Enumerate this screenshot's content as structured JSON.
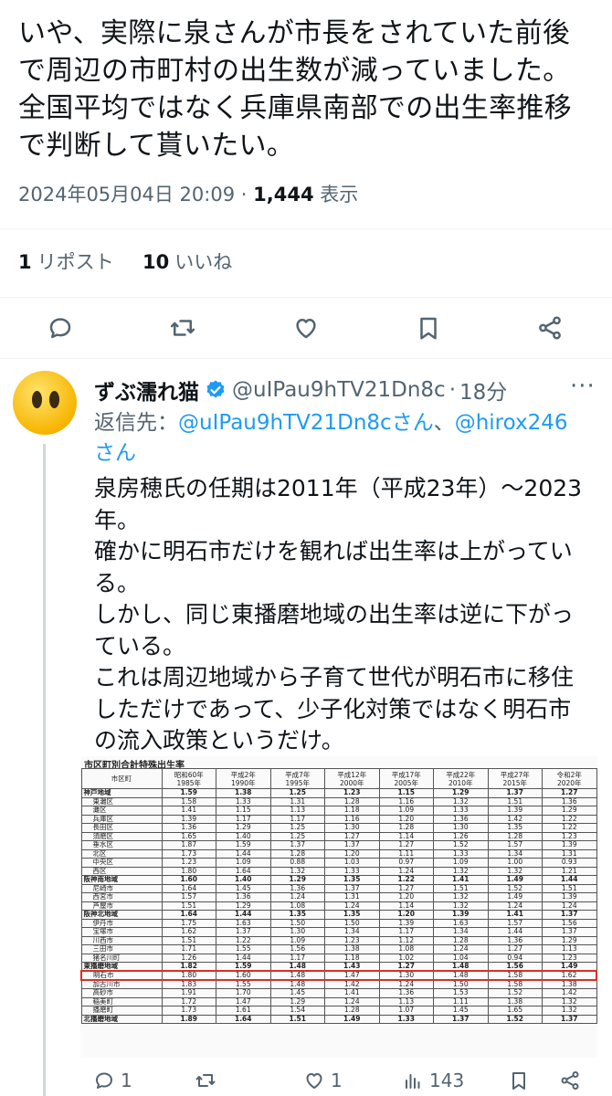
{
  "main_tweet": {
    "text": "いや、実際に泉さんが市長をされていた前後\nで周辺の市町村の出生数が減っていました。\n全国平均ではなく兵庫県南部での出生率推移\nで判断して貰いたい。",
    "timestamp": "2024年05月04日 20:09",
    "separator": "·",
    "views_count": "1,444",
    "views_label": "表示",
    "reposts_count": "1",
    "reposts_label": "リポスト",
    "likes_count": "10",
    "likes_label": "いいね"
  },
  "reply": {
    "display_name": "ずぶ濡れ猫",
    "handle": "@uIPau9hTV21Dn8c",
    "separator": "·",
    "time": "18分",
    "more": "···",
    "replying_label": "返信先：",
    "mention1": "@uIPau9hTV21Dn8cさん",
    "mention_sep": "、",
    "mention2": "@hirox246",
    "mention_suffix": "さん",
    "text": "泉房穂氏の任期は2011年（平成23年）～2023\n年。\n確かに明石市だけを観れば出生率は上がってい\nる。\nしかし、同じ東播磨地域の出生率は逆に下がっ\nている。\nこれは周辺地域から子育て世代が明石市に移住\nしただけであって、少子化対策ではなく明石市\nの流入政策というだけ。",
    "metrics": {
      "replies": "1",
      "reposts": "",
      "likes": "1",
      "views": "143"
    }
  },
  "table": {
    "caption": "市区町別合計特殊出生率",
    "headers": [
      "市区町",
      "昭和60年\n1985年",
      "平成2年\n1990年",
      "平成7年\n1995年",
      "平成12年\n2000年",
      "平成17年\n2005年",
      "平成22年\n2010年",
      "平成27年\n2015年",
      "令和2年\n2020年"
    ],
    "rows": [
      {
        "name": "神戸地域",
        "type": "region",
        "v": [
          "1.59",
          "1.38",
          "1.25",
          "1.23",
          "1.15",
          "1.29",
          "1.37",
          "1.27"
        ]
      },
      {
        "name": "東灘区",
        "v": [
          "1.58",
          "1.33",
          "1.31",
          "1.28",
          "1.16",
          "1.32",
          "1.51",
          "1.36"
        ]
      },
      {
        "name": "灘区",
        "v": [
          "1.41",
          "1.15",
          "1.13",
          "1.18",
          "1.09",
          "1.33",
          "1.39",
          "1.29"
        ]
      },
      {
        "name": "兵庫区",
        "v": [
          "1.39",
          "1.17",
          "1.17",
          "1.16",
          "1.20",
          "1.36",
          "1.42",
          "1.22"
        ]
      },
      {
        "name": "長田区",
        "v": [
          "1.36",
          "1.29",
          "1.25",
          "1.30",
          "1.28",
          "1.30",
          "1.35",
          "1.22"
        ]
      },
      {
        "name": "須磨区",
        "v": [
          "1.65",
          "1.40",
          "1.25",
          "1.27",
          "1.14",
          "1.26",
          "1.28",
          "1.23"
        ]
      },
      {
        "name": "垂水区",
        "v": [
          "1.87",
          "1.59",
          "1.37",
          "1.37",
          "1.27",
          "1.52",
          "1.57",
          "1.39"
        ]
      },
      {
        "name": "北区",
        "v": [
          "1.73",
          "1.44",
          "1.28",
          "1.20",
          "1.11",
          "1.33",
          "1.34",
          "1.31"
        ]
      },
      {
        "name": "中央区",
        "v": [
          "1.23",
          "1.09",
          "0.88",
          "1.03",
          "0.97",
          "1.09",
          "1.00",
          "0.93"
        ]
      },
      {
        "name": "西区",
        "v": [
          "1.80",
          "1.64",
          "1.32",
          "1.33",
          "1.24",
          "1.32",
          "1.32",
          "1.21"
        ]
      },
      {
        "name": "阪神南地域",
        "type": "region",
        "v": [
          "1.60",
          "1.40",
          "1.29",
          "1.35",
          "1.22",
          "1.41",
          "1.49",
          "1.44"
        ]
      },
      {
        "name": "尼崎市",
        "v": [
          "1.64",
          "1.45",
          "1.36",
          "1.37",
          "1.27",
          "1.51",
          "1.52",
          "1.51"
        ]
      },
      {
        "name": "西宮市",
        "v": [
          "1.57",
          "1.36",
          "1.24",
          "1.31",
          "1.20",
          "1.32",
          "1.49",
          "1.39"
        ]
      },
      {
        "name": "芦屋市",
        "v": [
          "1.51",
          "1.29",
          "1.08",
          "1.24",
          "1.14",
          "1.32",
          "1.24",
          "1.24"
        ]
      },
      {
        "name": "阪神北地域",
        "type": "region",
        "v": [
          "1.64",
          "1.44",
          "1.35",
          "1.35",
          "1.20",
          "1.39",
          "1.41",
          "1.37"
        ]
      },
      {
        "name": "伊丹市",
        "v": [
          "1.75",
          "1.63",
          "1.50",
          "1.50",
          "1.39",
          "1.63",
          "1.57",
          "1.56"
        ]
      },
      {
        "name": "宝塚市",
        "v": [
          "1.62",
          "1.37",
          "1.30",
          "1.34",
          "1.17",
          "1.34",
          "1.44",
          "1.37"
        ]
      },
      {
        "name": "川西市",
        "v": [
          "1.51",
          "1.22",
          "1.09",
          "1.23",
          "1.12",
          "1.28",
          "1.36",
          "1.29"
        ]
      },
      {
        "name": "三田市",
        "v": [
          "1.71",
          "1.55",
          "1.56",
          "1.38",
          "1.08",
          "1.24",
          "1.27",
          "1.13"
        ]
      },
      {
        "name": "猪名川町",
        "v": [
          "1.26",
          "1.44",
          "1.17",
          "1.18",
          "1.02",
          "1.04",
          "0.94",
          "1.23"
        ]
      },
      {
        "name": "東播磨地域",
        "type": "region",
        "v": [
          "1.82",
          "1.59",
          "1.48",
          "1.43",
          "1.27",
          "1.48",
          "1.56",
          "1.49"
        ]
      },
      {
        "name": "明石市",
        "highlight": true,
        "v": [
          "1.80",
          "1.60",
          "1.48",
          "1.47",
          "1.30",
          "1.48",
          "1.58",
          "1.62"
        ]
      },
      {
        "name": "加古川市",
        "v": [
          "1.83",
          "1.55",
          "1.48",
          "1.42",
          "1.24",
          "1.50",
          "1.58",
          "1.38"
        ]
      },
      {
        "name": "高砂市",
        "v": [
          "1.91",
          "1.70",
          "1.45",
          "1.41",
          "1.36",
          "1.53",
          "1.52",
          "1.42"
        ]
      },
      {
        "name": "稲美町",
        "v": [
          "1.72",
          "1.47",
          "1.29",
          "1.24",
          "1.13",
          "1.11",
          "1.38",
          "1.32"
        ]
      },
      {
        "name": "播磨町",
        "v": [
          "1.73",
          "1.61",
          "1.54",
          "1.28",
          "1.07",
          "1.45",
          "1.65",
          "1.32"
        ]
      },
      {
        "name": "北播磨地域",
        "type": "region",
        "v": [
          "1.89",
          "1.64",
          "1.51",
          "1.49",
          "1.33",
          "1.37",
          "1.52",
          "1.37"
        ]
      }
    ]
  },
  "colors": {
    "text": "#0f1419",
    "secondary": "#536471",
    "link": "#1d9bf0",
    "verified": "#1d9bf0",
    "highlight_border": "#d93025"
  },
  "icons": [
    "reply-icon",
    "repost-icon",
    "like-icon",
    "bookmark-icon",
    "share-icon",
    "views-icon",
    "verified-badge-icon",
    "more-icon"
  ]
}
